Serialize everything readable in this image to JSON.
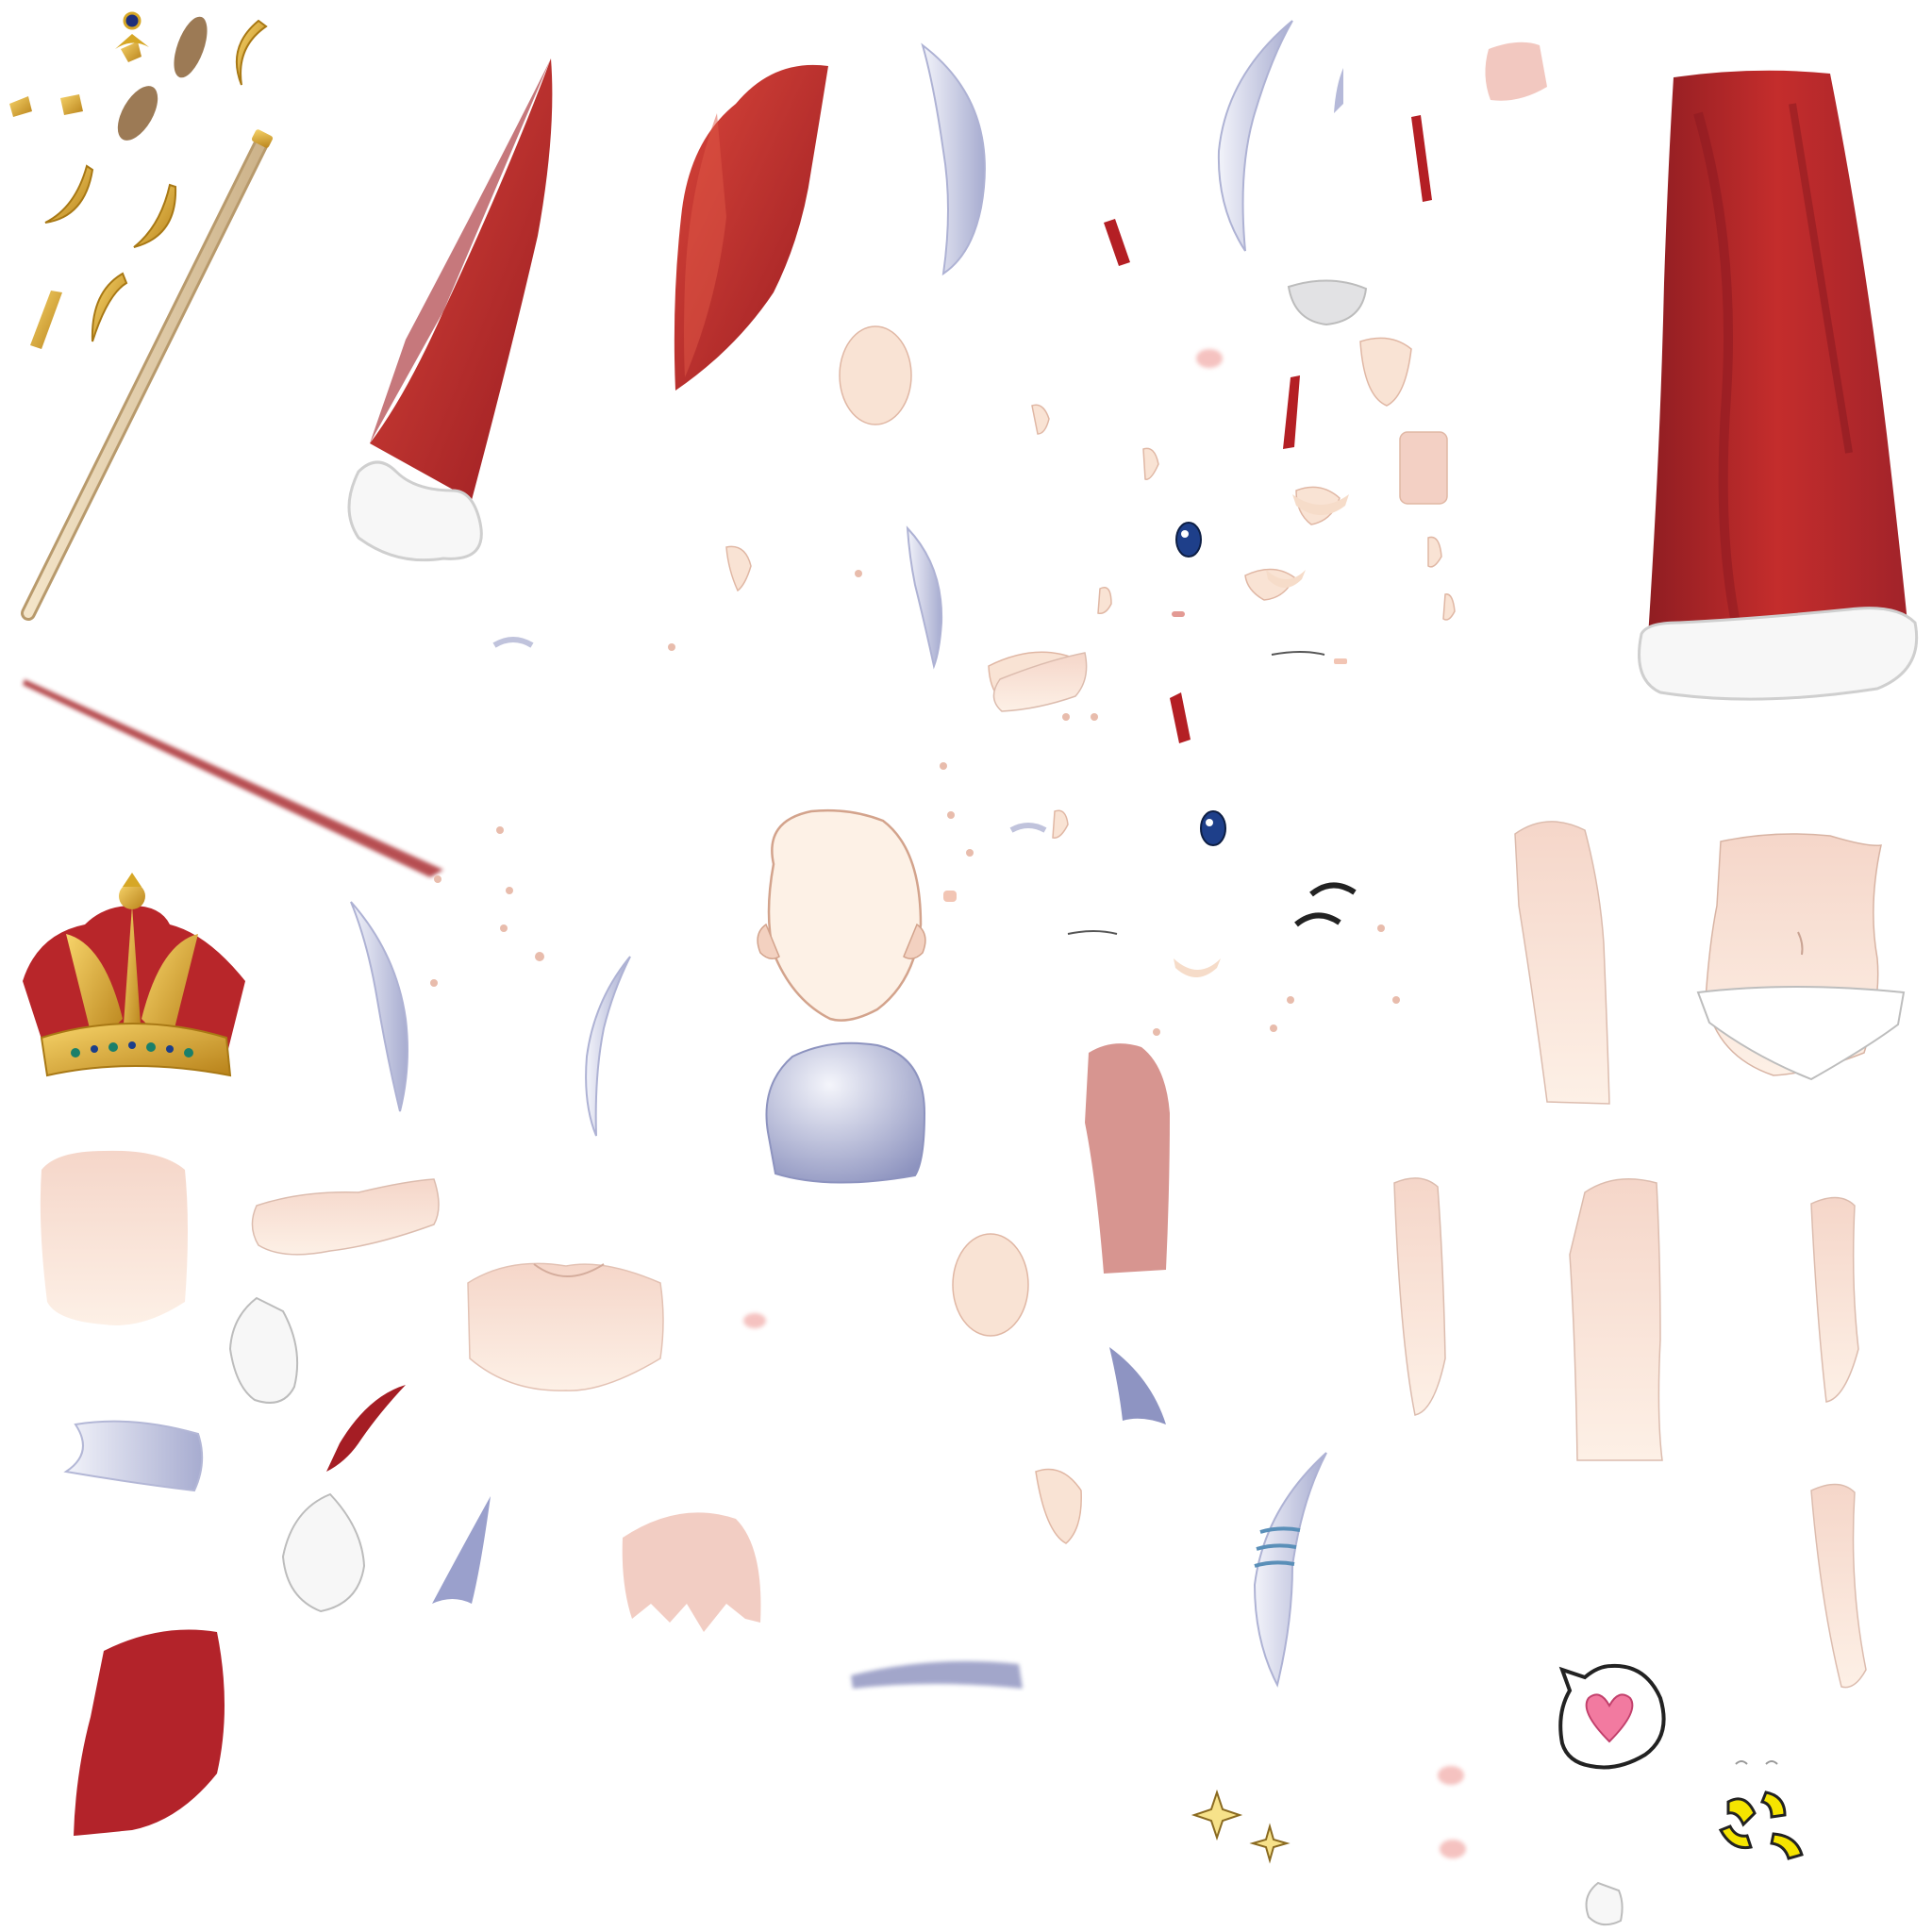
{
  "atlas": {
    "background": "#ffffff",
    "palette": {
      "hat_red": "#c4302b",
      "hat_dark": "#8e1a22",
      "fur_white": "#f7f7f7",
      "fur_shadow": "#d6d6d6",
      "hair_silver": "#d8dbeb",
      "hair_shadow": "#9aa0c8",
      "skin": "#fbe9dc",
      "skin_shade": "#f1cfc0",
      "gold": "#e0b02a",
      "gold_dark": "#a87814",
      "eye_blue": "#1e3f8a",
      "heart_pink": "#f27aa0",
      "anger_yellow": "#f5e400",
      "staff_beige": "#ecd9b9"
    },
    "parts": [
      "santa-hat-with-fur",
      "hat-flap",
      "long-red-cape",
      "royal-crown",
      "wooden-staff",
      "gold-ornaments",
      "silver-hair-strands",
      "head-base",
      "face-features",
      "eyes",
      "torso",
      "arms",
      "legs",
      "heart-speech-bubble",
      "anger-mark",
      "sparkles",
      "blush-marks"
    ]
  }
}
